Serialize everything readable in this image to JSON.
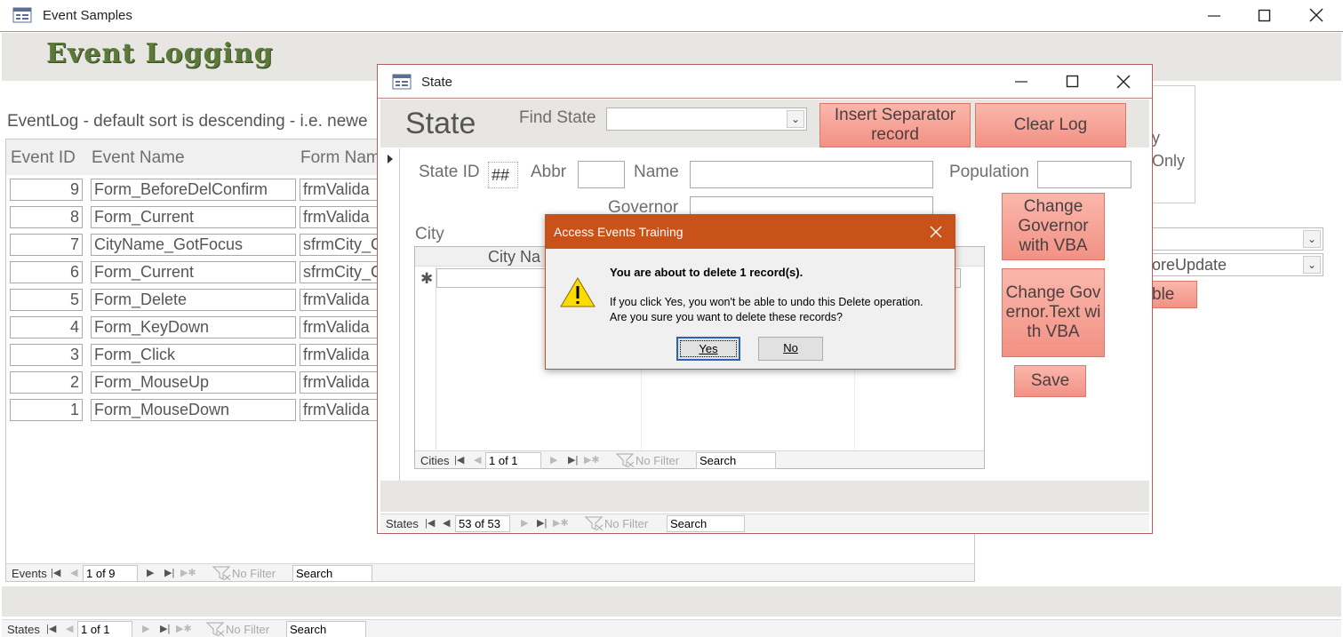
{
  "app": {
    "title": "Event Samples",
    "header_title": "Event Logging",
    "eventlog_caption": "EventLog - default sort is descending - i.e. newe",
    "columns": [
      "Event ID",
      "Event Name",
      "Form Nam"
    ],
    "rows": [
      {
        "id": "9",
        "name": "Form_BeforeDelConfirm",
        "form": "frmValida"
      },
      {
        "id": "8",
        "name": "Form_Current",
        "form": "frmValida"
      },
      {
        "id": "7",
        "name": "CityName_GotFocus",
        "form": "sfrmCity_C"
      },
      {
        "id": "6",
        "name": "Form_Current",
        "form": "sfrmCity_C"
      },
      {
        "id": "5",
        "name": "Form_Delete",
        "form": "frmValida"
      },
      {
        "id": "4",
        "name": "Form_KeyDown",
        "form": "frmValida"
      },
      {
        "id": "3",
        "name": "Form_Click",
        "form": "frmValida"
      },
      {
        "id": "2",
        "name": "Form_MouseUp",
        "form": "frmValida"
      },
      {
        "id": "1",
        "name": "Form_MouseDown",
        "form": "frmValida"
      }
    ],
    "right_panel": {
      "text1": "y",
      "text2": "Only",
      "combo2_value": "oreUpdate",
      "button_fragment": "ble"
    },
    "events_nav": {
      "label": "Events",
      "record": "1 of 9",
      "filter": "No Filter",
      "search": "Search"
    },
    "states_nav": {
      "label": "States",
      "record": "1 of 1",
      "filter": "No Filter",
      "search": "Search"
    }
  },
  "state_window": {
    "title": "State",
    "form_title": "State",
    "find_label": "Find State",
    "find_value": "",
    "insert_btn": "Insert Separator record",
    "clear_btn": "Clear Log",
    "state_id_label": "State ID",
    "state_id_value": "##",
    "abbr_label": "Abbr",
    "name_label": "Name",
    "population_label": "Population",
    "governor_label": "Governor",
    "change_gov_btn": "Change Governor with VBA",
    "change_gov_text_btn": "Change Governor.Text with VBA",
    "save_btn": "Save",
    "city_label": "City",
    "city_col": "City Na",
    "cities_nav": {
      "label": "Cities",
      "record": "1 of 1",
      "filter": "No Filter",
      "search": "Search"
    },
    "states_nav": {
      "label": "States",
      "record": "53 of 53",
      "filter": "No Filter",
      "search": "Search"
    }
  },
  "dialog": {
    "title": "Access Events Training",
    "heading": "You are about to delete 1 record(s).",
    "line1": "If you click Yes, you won't be able to undo this Delete operation.",
    "line2": "Are you sure you want to delete these records?",
    "yes": "Yes",
    "no": "No"
  },
  "colors": {
    "accent": "#c9521a",
    "button": "#f29184",
    "header_band": "#e8e6e2",
    "title_green": "#5a7a3a"
  },
  "icons": [
    "form-icon",
    "minimize-icon",
    "maximize-icon",
    "close-icon",
    "warning-icon",
    "record-selector-icon",
    "new-record-icon",
    "filter-icon",
    "first-record-icon",
    "prev-record-icon",
    "next-record-icon",
    "last-record-icon",
    "new-nav-icon",
    "dropdown-icon"
  ]
}
